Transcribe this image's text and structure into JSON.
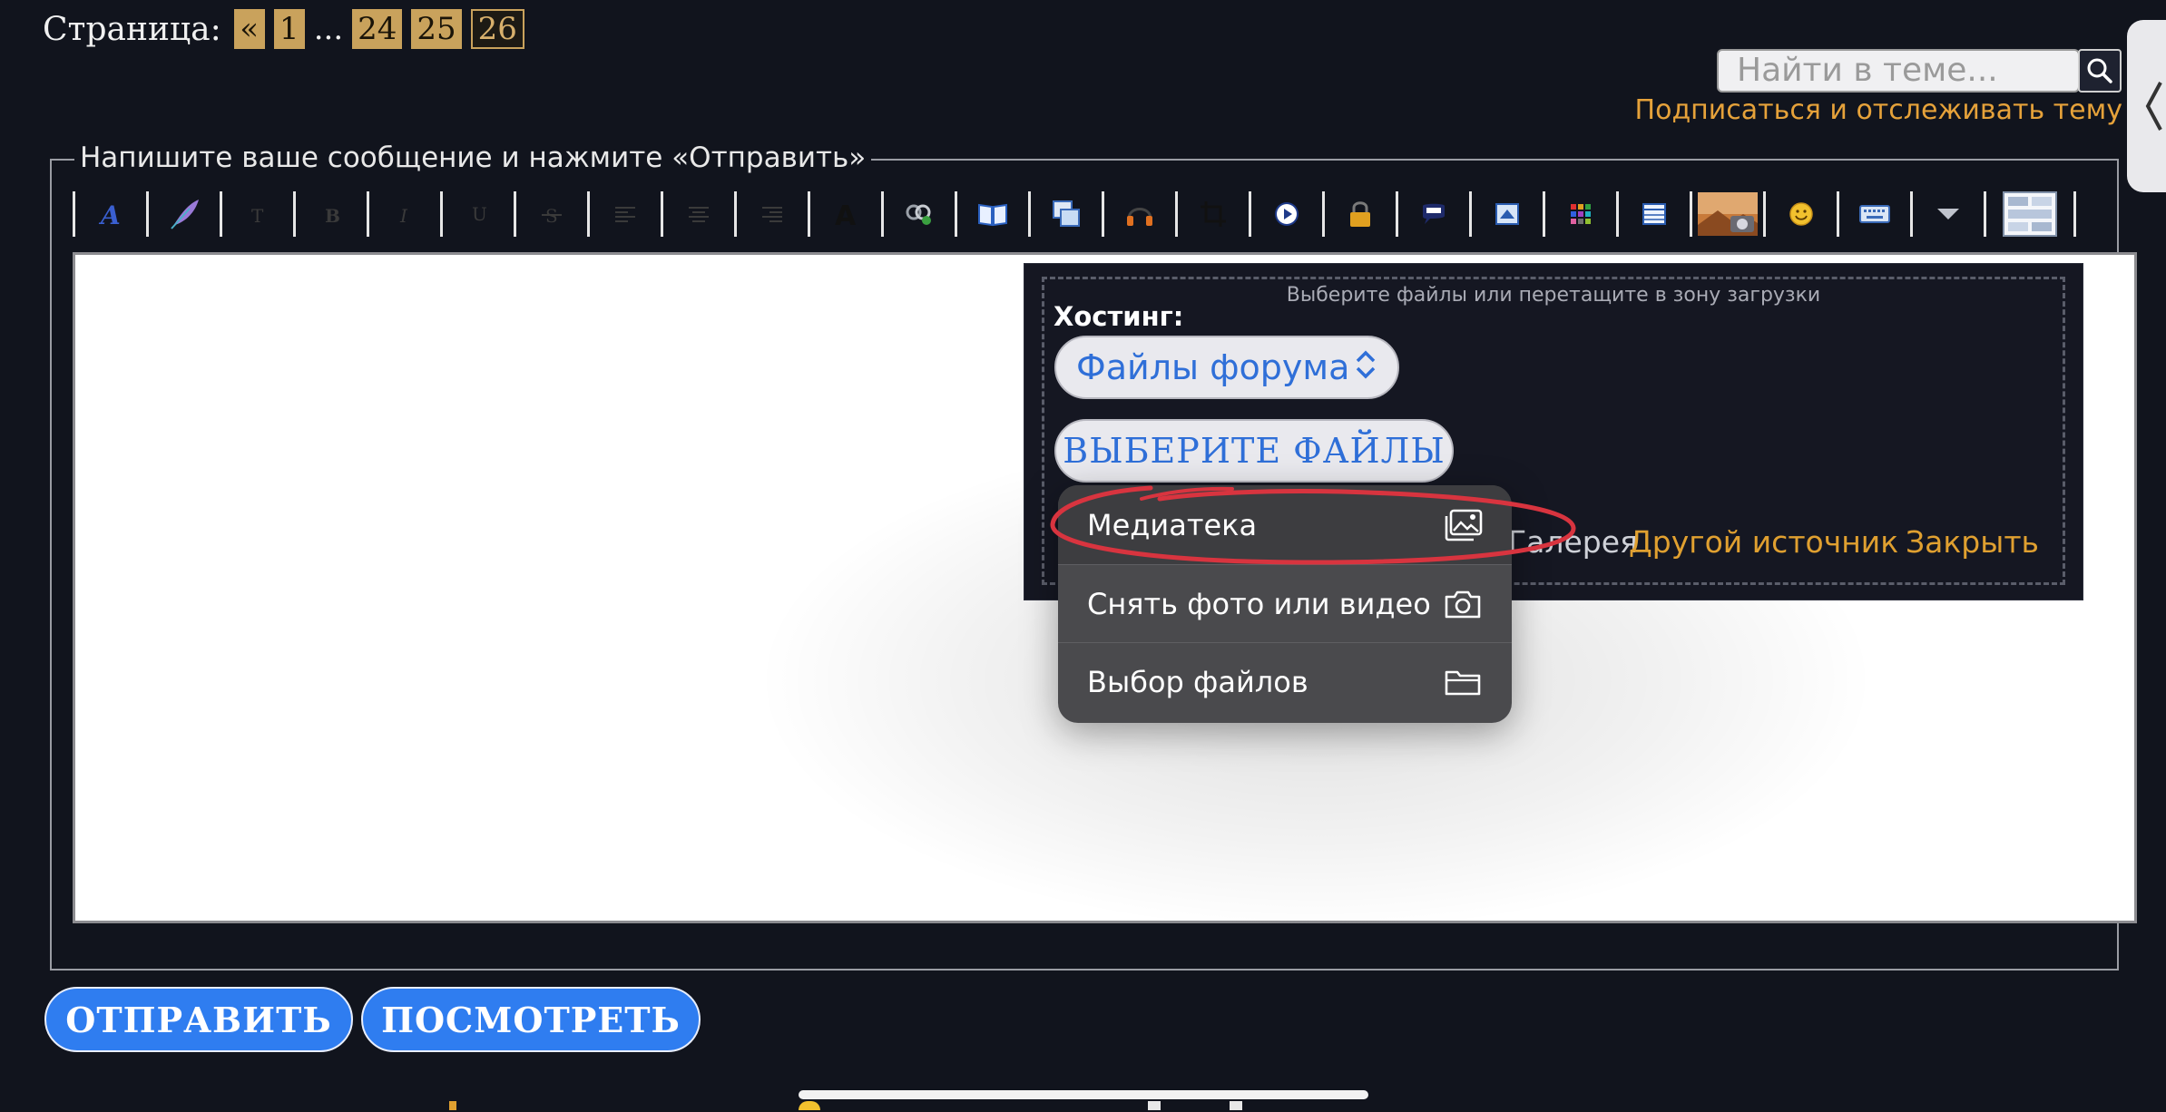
{
  "pagination": {
    "label": "Страница:",
    "prev": "«",
    "pages": [
      "1",
      "24",
      "25",
      "26"
    ],
    "ellipsis": "...",
    "current": "26"
  },
  "search": {
    "placeholder": "Найти в теме..."
  },
  "subscribe_link": "Подписаться и отслеживать тему",
  "side_tab_glyph": "❬",
  "reply": {
    "legend": "Напишите ваше сообщение и нажмите «Отправить»",
    "toolbar_icons": [
      "font-style-icon",
      "feather-icon",
      "text-size-icon",
      "bold-icon",
      "italic-icon",
      "underline-icon",
      "strikethrough-icon",
      "align-left-icon",
      "align-center-icon",
      "align-right-icon",
      "font-color-icon",
      "link-icon",
      "book-icon",
      "copy-icon",
      "headphones-icon",
      "crop-icon",
      "play-icon",
      "lock-icon",
      "speech-bubble-icon",
      "image-edit-icon",
      "color-grid-icon",
      "table-icon",
      "photo-camera-icon",
      "smiley-icon",
      "keyboard-icon",
      "dropdown-arrow-icon",
      "layout-icon"
    ]
  },
  "upload": {
    "drop_hint": "Выберите файлы или перетащите в зону загрузки",
    "hosting_label": "Хостинг:",
    "hosting_value": "Файлы форума",
    "choose_button": "ВЫБЕРИТЕ ФАЙЛЫ",
    "gallery_link": "Галерея",
    "other_source_link": "Другой источник",
    "close_link": "Закрыть"
  },
  "file_picker_menu": {
    "items": [
      {
        "label": "Медиатека",
        "icon": "photo-library-icon"
      },
      {
        "label": "Снять фото или видео",
        "icon": "camera-icon"
      },
      {
        "label": "Выбор файлов",
        "icon": "folder-icon"
      }
    ],
    "highlight_color": "#d8343f"
  },
  "actions": {
    "send": "ОТПРАВИТЬ",
    "preview": "ПОСМОТРЕТЬ"
  },
  "colors": {
    "accent_link": "#e0a030",
    "button_blue": "#2f7df0",
    "page_gold": "#c9a25c"
  }
}
